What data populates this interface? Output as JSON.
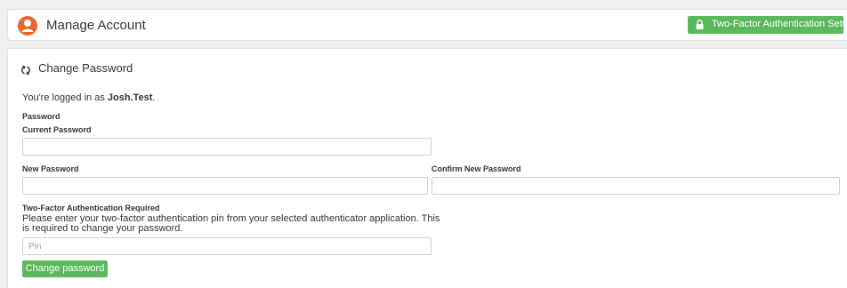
{
  "header": {
    "title": "Manage Account",
    "tfa_button_label": "Two-Factor Authentication Setup"
  },
  "panel": {
    "title": "Change Password",
    "logged_in_prefix": "You're logged in as ",
    "username": "Josh.Test",
    "logged_in_suffix": ".",
    "password_heading": "Password",
    "current_password_label": "Current Password",
    "current_password_value": "",
    "new_password_label": "New Password",
    "new_password_value": "",
    "confirm_password_label": "Confirm New Password",
    "confirm_password_value": "",
    "tfa_required_label": "Two-Factor Authentication Required",
    "tfa_note": "Please enter your two-factor authentication pin from your selected authenticator application. This is required to change your password.",
    "pin_placeholder": "Pin",
    "submit_label": "Change password"
  },
  "colors": {
    "accent_green": "#5cb85c",
    "avatar_orange": "#e8672a"
  },
  "icons": {
    "avatar": "user-circle-icon",
    "tfa": "lock-icon",
    "section": "refresh-icon"
  }
}
